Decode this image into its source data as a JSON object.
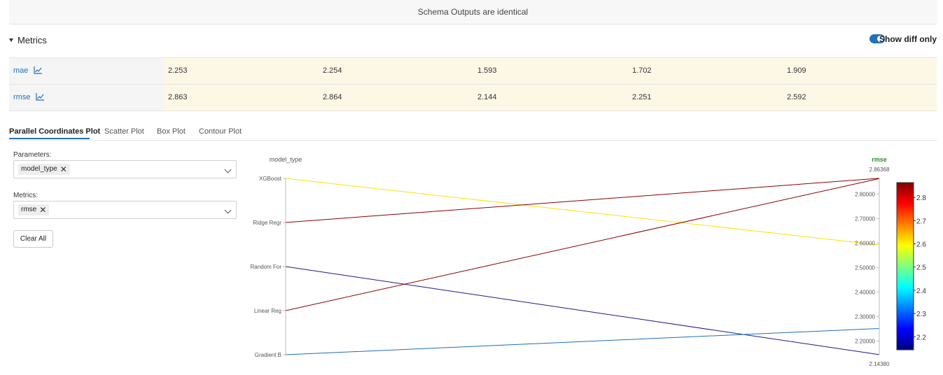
{
  "banner": {
    "text": "Schema Outputs are identical"
  },
  "metrics_section": {
    "title": "Metrics",
    "toggle_label": "Show diff only",
    "toggle_on": true,
    "rows": [
      {
        "name": "mae",
        "values": [
          "2.253",
          "2.254",
          "1.593",
          "1.702",
          "1.909"
        ]
      },
      {
        "name": "rmse",
        "values": [
          "2.863",
          "2.864",
          "2.144",
          "2.251",
          "2.592"
        ]
      }
    ]
  },
  "tabs": [
    {
      "label": "Parallel Coordinates Plot",
      "active": true
    },
    {
      "label": "Scatter Plot",
      "active": false
    },
    {
      "label": "Box Plot",
      "active": false
    },
    {
      "label": "Contour Plot",
      "active": false
    }
  ],
  "controls": {
    "parameters_label": "Parameters:",
    "parameters_selected": [
      "model_type"
    ],
    "metrics_label": "Metrics:",
    "metrics_selected": [
      "rmse"
    ],
    "clear_all_label": "Clear All"
  },
  "chart_data": {
    "type": "parallel_coordinates",
    "dimensions": [
      {
        "label": "model_type",
        "type": "categorical",
        "categories": [
          "XGBoost",
          "Ridge Regr",
          "Random For",
          "Linear Reg",
          "Gradient B"
        ]
      },
      {
        "label": "rmse",
        "type": "numeric",
        "range": [
          2.1438,
          2.86368
        ],
        "range_labels": [
          "2.14380",
          "2.86368"
        ],
        "ticks": [
          2.2,
          2.3,
          2.4,
          2.5,
          2.6,
          2.7,
          2.8
        ],
        "tick_labels": [
          "2.20000",
          "2.30000",
          "2.40000",
          "2.50000",
          "2.60000",
          "2.70000",
          "2.80000"
        ]
      }
    ],
    "lines": [
      {
        "model_type": "XGBoost",
        "rmse": 2.592,
        "color": "#ffe100"
      },
      {
        "model_type": "Ridge Regr",
        "rmse": 2.864,
        "color": "#8b0000"
      },
      {
        "model_type": "Random For",
        "rmse": 2.144,
        "color": "#1a1a8a"
      },
      {
        "model_type": "Linear Reg",
        "rmse": 2.863,
        "color": "#8b0000"
      },
      {
        "model_type": "Gradient B",
        "rmse": 2.251,
        "color": "#1f6fb4"
      }
    ],
    "colorbar": {
      "colorscale": "jet",
      "range": [
        2.1438,
        2.86368
      ],
      "ticks": [
        2.2,
        2.3,
        2.4,
        2.5,
        2.6,
        2.7,
        2.8
      ],
      "tick_labels": [
        "2.2",
        "2.3",
        "2.4",
        "2.5",
        "2.6",
        "2.7",
        "2.8"
      ]
    },
    "colors": {
      "axis_title_rmse": "#2e8b2e",
      "axis": "#bbbbbb",
      "tick_text": "#555555"
    }
  }
}
